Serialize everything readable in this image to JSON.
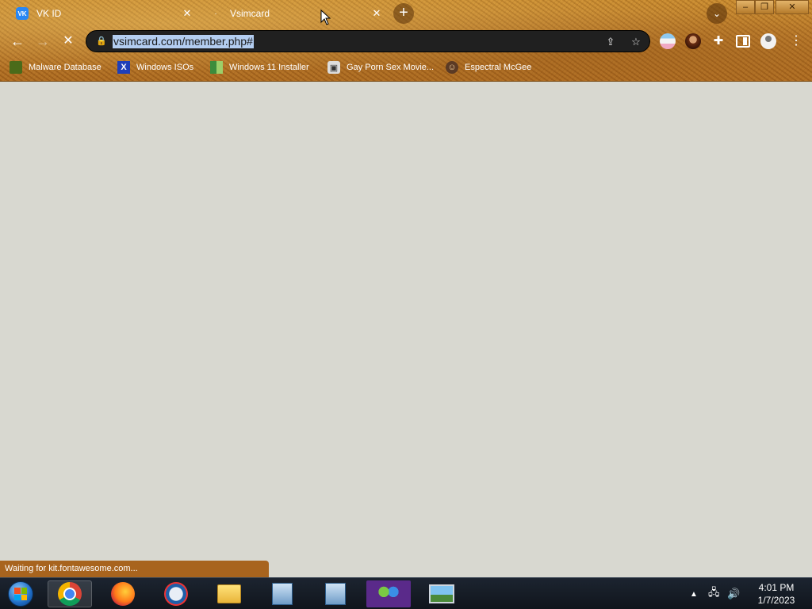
{
  "tabs": [
    {
      "title": "VK ID",
      "favicon": "vk-icon"
    },
    {
      "title": "Vsimcard",
      "favicon": "loading-icon"
    }
  ],
  "new_tab_label": "+",
  "toolbar": {
    "url": "vsimcard.com/member.php#"
  },
  "bookmarks": [
    {
      "label": "Malware Database",
      "icon": "malware-icon"
    },
    {
      "label": "Windows ISOs",
      "icon": "x-icon"
    },
    {
      "label": "Windows 11 Installer",
      "icon": "windows-installer-icon"
    },
    {
      "label": "Gay Porn Sex Movie...",
      "icon": "film-icon"
    },
    {
      "label": "Espectral McGee",
      "icon": "avatar-icon"
    }
  ],
  "status": "Waiting for kit.fontawesome.com...",
  "taskbar": {
    "time": "4:01 PM",
    "date": "1/7/2023"
  },
  "colors": {
    "theme_brown": "#b8772a",
    "page_bg": "#d8d8d0",
    "url_selection": "#b3cdf0"
  }
}
